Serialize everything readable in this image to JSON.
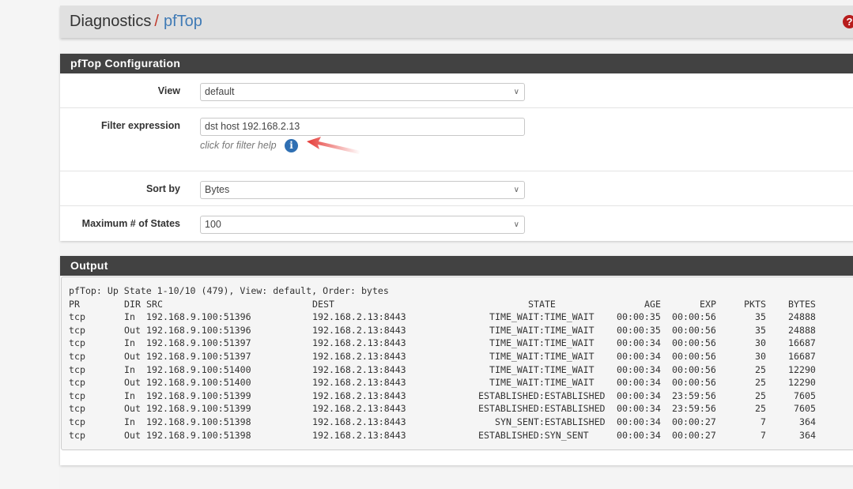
{
  "breadcrumb": {
    "parent": "Diagnostics",
    "separator": "/",
    "current": "pfTop"
  },
  "help_icon": "question-circle-icon",
  "colors": {
    "header_dark": "#424242",
    "link_blue": "#3f7ab5",
    "help_red": "#b71c1c",
    "info_blue": "#2f6fb3"
  },
  "config": {
    "title": "pfTop Configuration",
    "view": {
      "label": "View",
      "value": "default"
    },
    "filter": {
      "label": "Filter expression",
      "value": "dst host 192.168.2.13",
      "help": "click for filter help"
    },
    "sort": {
      "label": "Sort by",
      "value": "Bytes"
    },
    "max_states": {
      "label": "Maximum # of States",
      "value": "100"
    }
  },
  "output": {
    "title": "Output",
    "summary": "pfTop: Up State 1-10/10 (479), View: default, Order: bytes",
    "headers": {
      "pr": "PR",
      "dir": "DIR",
      "src": "SRC",
      "dest": "DEST",
      "state": "STATE",
      "age": "AGE",
      "exp": "EXP",
      "pkts": "PKTS",
      "bytes": "BYTES"
    },
    "rows": [
      {
        "pr": "tcp",
        "dir": "In",
        "src": "192.168.9.100:51396",
        "dest": "192.168.2.13:8443",
        "state": "TIME_WAIT:TIME_WAIT",
        "age": "00:00:35",
        "exp": "00:00:56",
        "pkts": "35",
        "bytes": "24888"
      },
      {
        "pr": "tcp",
        "dir": "Out",
        "src": "192.168.9.100:51396",
        "dest": "192.168.2.13:8443",
        "state": "TIME_WAIT:TIME_WAIT",
        "age": "00:00:35",
        "exp": "00:00:56",
        "pkts": "35",
        "bytes": "24888"
      },
      {
        "pr": "tcp",
        "dir": "In",
        "src": "192.168.9.100:51397",
        "dest": "192.168.2.13:8443",
        "state": "TIME_WAIT:TIME_WAIT",
        "age": "00:00:34",
        "exp": "00:00:56",
        "pkts": "30",
        "bytes": "16687"
      },
      {
        "pr": "tcp",
        "dir": "Out",
        "src": "192.168.9.100:51397",
        "dest": "192.168.2.13:8443",
        "state": "TIME_WAIT:TIME_WAIT",
        "age": "00:00:34",
        "exp": "00:00:56",
        "pkts": "30",
        "bytes": "16687"
      },
      {
        "pr": "tcp",
        "dir": "In",
        "src": "192.168.9.100:51400",
        "dest": "192.168.2.13:8443",
        "state": "TIME_WAIT:TIME_WAIT",
        "age": "00:00:34",
        "exp": "00:00:56",
        "pkts": "25",
        "bytes": "12290"
      },
      {
        "pr": "tcp",
        "dir": "Out",
        "src": "192.168.9.100:51400",
        "dest": "192.168.2.13:8443",
        "state": "TIME_WAIT:TIME_WAIT",
        "age": "00:00:34",
        "exp": "00:00:56",
        "pkts": "25",
        "bytes": "12290"
      },
      {
        "pr": "tcp",
        "dir": "In",
        "src": "192.168.9.100:51399",
        "dest": "192.168.2.13:8443",
        "state": "ESTABLISHED:ESTABLISHED",
        "age": "00:00:34",
        "exp": "23:59:56",
        "pkts": "25",
        "bytes": "7605"
      },
      {
        "pr": "tcp",
        "dir": "Out",
        "src": "192.168.9.100:51399",
        "dest": "192.168.2.13:8443",
        "state": "ESTABLISHED:ESTABLISHED",
        "age": "00:00:34",
        "exp": "23:59:56",
        "pkts": "25",
        "bytes": "7605"
      },
      {
        "pr": "tcp",
        "dir": "In",
        "src": "192.168.9.100:51398",
        "dest": "192.168.2.13:8443",
        "state": "SYN_SENT:ESTABLISHED",
        "age": "00:00:34",
        "exp": "00:00:27",
        "pkts": "7",
        "bytes": "364"
      },
      {
        "pr": "tcp",
        "dir": "Out",
        "src": "192.168.9.100:51398",
        "dest": "192.168.2.13:8443",
        "state": "ESTABLISHED:SYN_SENT",
        "age": "00:00:34",
        "exp": "00:00:27",
        "pkts": "7",
        "bytes": "364"
      }
    ]
  }
}
